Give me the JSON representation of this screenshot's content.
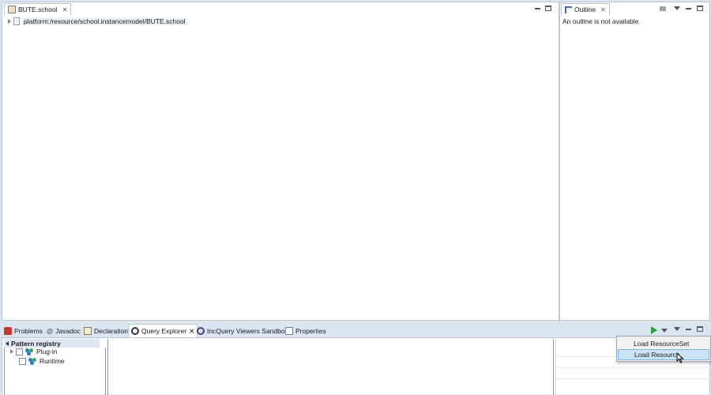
{
  "editor": {
    "tab_label": "BUTE.school",
    "tree": [
      {
        "label": "platform:/resource/school.instancemodel/BUTE.school"
      }
    ]
  },
  "outline": {
    "tab_label": "Outline",
    "message": "An outline is not available."
  },
  "bottom": {
    "tabs": [
      {
        "label": "Problems",
        "icon": "problems-icon"
      },
      {
        "label": "Javadoc",
        "icon": "at-icon"
      },
      {
        "label": "Declaration",
        "icon": "declaration-icon"
      },
      {
        "label": "Query Explorer",
        "icon": "query-explorer-icon",
        "active": true
      },
      {
        "label": "IncQuery Viewers Sandbox",
        "icon": "incquery-icon"
      },
      {
        "label": "Properties",
        "icon": "properties-icon"
      }
    ],
    "registry": {
      "header": "Pattern registry",
      "items": [
        {
          "label": "Plug-in"
        },
        {
          "label": "Runtime"
        }
      ]
    },
    "dropdown": {
      "items": [
        {
          "label": "Load ResourceSet"
        },
        {
          "label": "Load Resource"
        }
      ]
    }
  },
  "colors": {
    "background": "#dbe5f1",
    "pane_border": "#b9c6d8",
    "menu_hover": "#cce4f7",
    "play_green": "#2e9e3a"
  }
}
